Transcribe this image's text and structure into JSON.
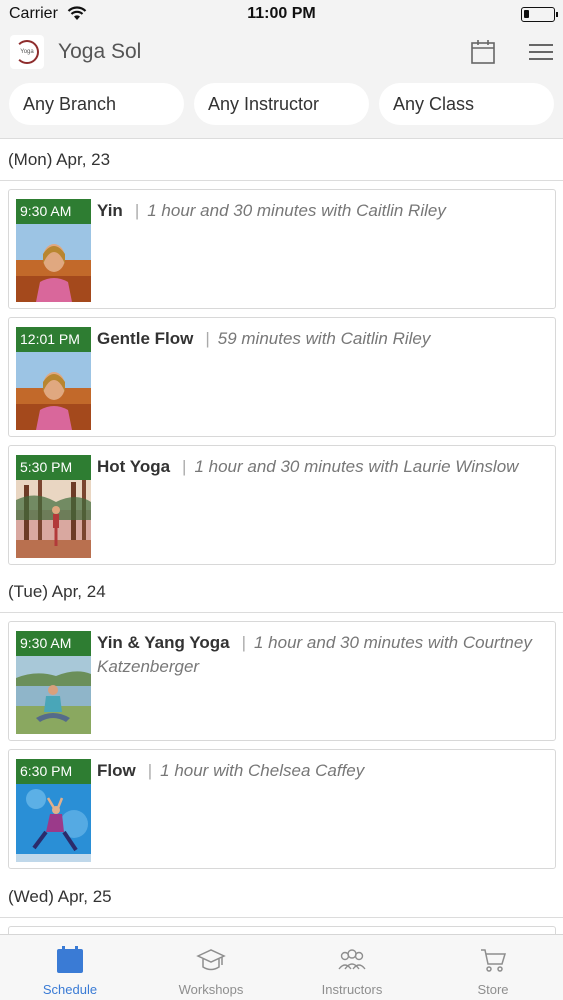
{
  "status_bar": {
    "carrier": "Carrier",
    "time": "11:00 PM"
  },
  "header": {
    "title": "Yoga Sol",
    "logo_text": "Yoga Sol"
  },
  "filters": [
    {
      "label": "Any Branch"
    },
    {
      "label": "Any Instructor"
    },
    {
      "label": "Any Class"
    }
  ],
  "days": [
    {
      "date": "(Mon) Apr, 23",
      "classes": [
        {
          "time": "9:30 AM",
          "name": "Yin",
          "detail": "1 hour and 30 minutes with Caitlin Riley",
          "thumb": "portrait-woman-autumn"
        },
        {
          "time": "12:01 PM",
          "name": "Gentle Flow",
          "detail": "59 minutes with Caitlin Riley",
          "thumb": "portrait-woman-autumn"
        },
        {
          "time": "5:30 PM",
          "name": "Hot Yoga",
          "detail": "1 hour and 30 minutes with Laurie Winslow",
          "thumb": "forest-yoga-pose"
        }
      ]
    },
    {
      "date": "(Tue) Apr, 24",
      "classes": [
        {
          "time": "9:30 AM",
          "name": "Yin & Yang Yoga",
          "detail": "1 hour and 30 minutes with Courtney Katzenberger",
          "thumb": "meditation-lake"
        },
        {
          "time": "6:30 PM",
          "name": "Flow",
          "detail": "1 hour with Chelsea Caffey",
          "thumb": "dancer-blue"
        }
      ]
    },
    {
      "date": "(Wed) Apr, 25",
      "classes": []
    }
  ],
  "tabs": [
    {
      "label": "Schedule",
      "icon": "calendar-icon",
      "active": true
    },
    {
      "label": "Workshops",
      "icon": "graduation-cap-icon",
      "active": false
    },
    {
      "label": "Instructors",
      "icon": "people-icon",
      "active": false
    },
    {
      "label": "Store",
      "icon": "cart-icon",
      "active": false
    }
  ],
  "colors": {
    "accent": "#3a7bd5",
    "badge": "#2e7d32",
    "header_bg": "#f3f3f3"
  }
}
